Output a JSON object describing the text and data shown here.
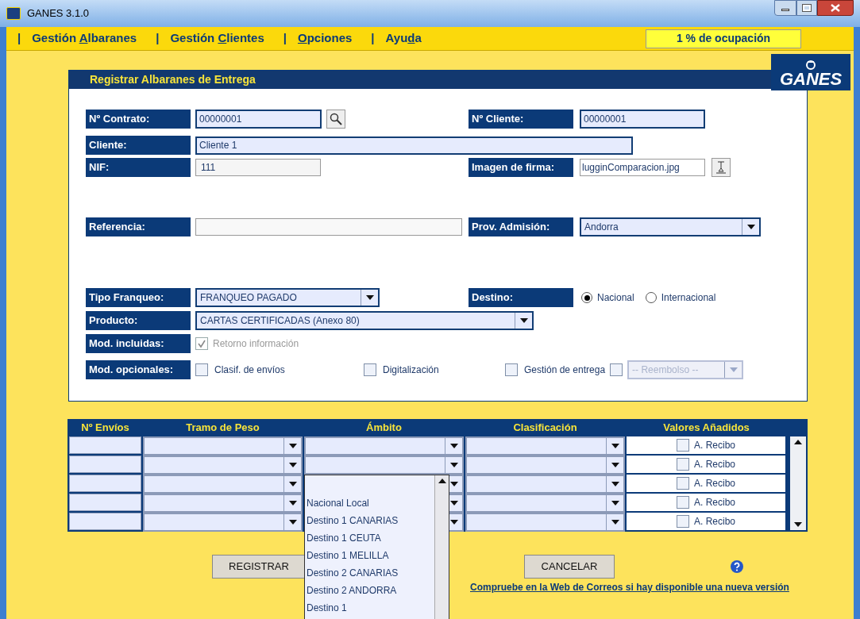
{
  "window": {
    "title": "GANES 3.1.0"
  },
  "menu": [
    {
      "separator": "|",
      "before": "Gestión ",
      "key": "A",
      "after": "lbaranes"
    },
    {
      "separator": "|",
      "before": "Gestión ",
      "key": "C",
      "after": "lientes"
    },
    {
      "separator": "|",
      "key": "O",
      "after": "pciones"
    },
    {
      "separator": "|",
      "before": "Ayu",
      "key": "d",
      "after": "a"
    }
  ],
  "occupancy": "1 % de ocupación",
  "logo": "GANES",
  "panel": {
    "title": "Registrar Albaranes de Entrega"
  },
  "contrato": {
    "label": "Nº Contrato:",
    "value": "00000001"
  },
  "cliente_no": {
    "label": "Nº Cliente:",
    "value": "00000001"
  },
  "cliente": {
    "label": "Cliente:",
    "value": "Cliente 1"
  },
  "nif": {
    "label": "NIF:",
    "value": "111"
  },
  "imagen_firma": {
    "label": "Imagen de firma:",
    "value": "lugginComparacion.jpg"
  },
  "referencia": {
    "label": "Referencia:"
  },
  "prov_admision": {
    "label": "Prov. Admisión:",
    "value": "Andorra"
  },
  "tipo_franqueo": {
    "label": "Tipo Franqueo:",
    "value": "FRANQUEO PAGADO"
  },
  "destino": {
    "label": "Destino:",
    "options": [
      {
        "label": "Nacional",
        "selected": true
      },
      {
        "label": "Internacional",
        "selected": false
      }
    ]
  },
  "producto": {
    "label": "Producto:",
    "value": "CARTAS CERTIFICADAS (Anexo 80)"
  },
  "mod_incluidas": {
    "label": "Mod. incluidas:",
    "options": [
      {
        "label": "Retorno información",
        "checked": true,
        "disabled": true
      }
    ]
  },
  "mod_opcionales": {
    "label": "Mod. opcionales:",
    "options": [
      {
        "label": "Clasif. de envíos",
        "checked": false
      },
      {
        "label": "Digitalización",
        "checked": false
      },
      {
        "label": "Gestión de entrega",
        "checked": false
      }
    ],
    "reembolso": {
      "checked": false,
      "disabled": true,
      "value": "-- Reembolso --"
    }
  },
  "table": {
    "columns": [
      "Nº Envíos",
      "Tramo de Peso",
      "Ámbito",
      "Clasificación",
      "Valores Añadidos"
    ],
    "rows": [
      {
        "valores": "A. Recibo",
        "checked": false
      },
      {
        "valores": "A. Recibo",
        "checked": false
      },
      {
        "valores": "A. Recibo",
        "checked": false
      },
      {
        "valores": "A. Recibo",
        "checked": false
      },
      {
        "valores": "A. Recibo",
        "checked": false
      }
    ]
  },
  "dropdown": {
    "options": [
      "Nacional Local",
      "Destino 1 CANARIAS",
      "Destino 1 CEUTA",
      "Destino 1 MELILLA",
      "Destino 2 CANARIAS",
      "Destino 2 ANDORRA",
      "Destino 1"
    ]
  },
  "buttons": [
    "REGISTRAR",
    "CANCELAR"
  ],
  "link": "Compruebe en la Web de Correos si hay disponible una nueva versión"
}
